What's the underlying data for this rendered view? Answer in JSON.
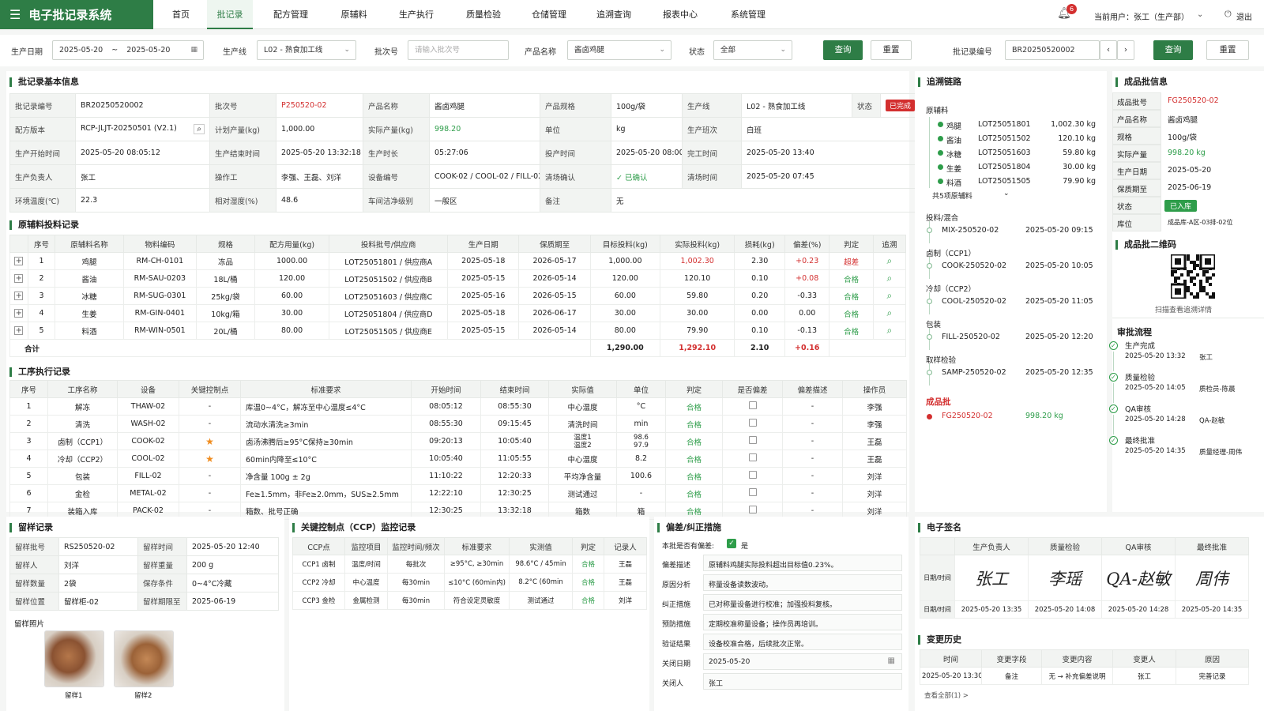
{
  "app": {
    "title": "电子批记录系统",
    "menu_icon": "menu-icon"
  },
  "nav": [
    "首页",
    "批记录",
    "配方管理",
    "原辅料",
    "生产执行",
    "质量检验",
    "仓储管理",
    "追溯查询",
    "报表中心",
    "系统管理"
  ],
  "header": {
    "notif_count": "6",
    "user": "当前用户：张工（生产部）",
    "logout": "退出"
  },
  "filters": {
    "date_label": "生产日期",
    "date_from": "2025-05-20",
    "date_sep": "~",
    "date_to": "2025-05-20",
    "line_label": "生产线",
    "line_value": "L02 - 熟食加工线",
    "batch_label": "批次号",
    "batch_placeholder": "请输入批次号",
    "product_label": "产品名称",
    "product_value": "酱卤鸡腿",
    "status_label": "状态",
    "status_value": "全部",
    "query": "查询",
    "reset": "重置",
    "record_label": "批记录编号",
    "record_value": "BR20250520002",
    "query2": "查询",
    "reset2": "重置"
  },
  "basic": {
    "title": "批记录基本信息",
    "rows": [
      [
        [
          "批记录编号",
          "BR20250520002"
        ],
        [
          "批次号",
          "P250520-02"
        ],
        [
          "产品名称",
          "酱卤鸡腿"
        ],
        [
          "产品规格",
          "100g/袋"
        ],
        [
          "生产线",
          "L02 - 熟食加工线"
        ],
        [
          "状态",
          "已完成"
        ]
      ],
      [
        [
          "配方版本",
          "RCP-JLJT-20250501 (V2.1)"
        ],
        [
          "计划产量(kg)",
          "1,000.00"
        ],
        [
          "实际产量(kg)",
          "998.20"
        ],
        [
          "单位",
          "kg"
        ],
        [
          "生产班次",
          "白班"
        ]
      ],
      [
        [
          "生产开始时间",
          "2025-05-20 08:05:12"
        ],
        [
          "生产结束时间",
          "2025-05-20 13:32:18"
        ],
        [
          "生产时长",
          "05:27:06"
        ],
        [
          "投产时间",
          "2025-05-20 08:00"
        ],
        [
          "完工时间",
          "2025-05-20 13:40"
        ]
      ],
      [
        [
          "生产负责人",
          "张工"
        ],
        [
          "操作工",
          "李强、王磊、刘洋"
        ],
        [
          "设备编号",
          "COOK-02 / COOL-02 / FILL-02"
        ],
        [
          "清场确认",
          "✓ 已确认"
        ],
        [
          "清场时间",
          "2025-05-20 07:45"
        ]
      ],
      [
        [
          "环境温度(℃)",
          "22.3"
        ],
        [
          "相对湿度(%)",
          "48.6"
        ],
        [
          "车间洁净级别",
          "一般区"
        ],
        [
          "备注",
          "无"
        ]
      ]
    ]
  },
  "materials": {
    "title": "原辅料投料记录",
    "headers": [
      "",
      "序号",
      "原辅料名称",
      "物料编码",
      "规格",
      "配方用量(kg)",
      "投料批号/供应商",
      "生产日期",
      "保质期至",
      "目标投料(kg)",
      "实际投料(kg)",
      "损耗(kg)",
      "偏差(%)",
      "判定",
      "追溯"
    ],
    "rows": [
      [
        "1",
        "鸡腿",
        "RM-CH-0101",
        "冻品",
        "1000.00",
        "LOT25051801 / 供应商A",
        "2025-05-18",
        "2026-05-17",
        "1,000.00",
        "1,002.30",
        "2.30",
        "+0.23",
        "超差"
      ],
      [
        "2",
        "酱油",
        "RM-SAU-0203",
        "18L/桶",
        "120.00",
        "LOT25051502 / 供应商B",
        "2025-05-15",
        "2026-05-14",
        "120.00",
        "120.10",
        "0.10",
        "+0.08",
        "合格"
      ],
      [
        "3",
        "冰糖",
        "RM-SUG-0301",
        "25kg/袋",
        "60.00",
        "LOT25051603 / 供应商C",
        "2025-05-16",
        "2026-05-15",
        "60.00",
        "59.80",
        "0.20",
        "-0.33",
        "合格"
      ],
      [
        "4",
        "生姜",
        "RM-GIN-0401",
        "10kg/箱",
        "30.00",
        "LOT25051804 / 供应商D",
        "2025-05-18",
        "2026-06-17",
        "30.00",
        "30.00",
        "0.00",
        "0.00",
        "合格"
      ],
      [
        "5",
        "料酒",
        "RM-WIN-0501",
        "20L/桶",
        "80.00",
        "LOT25051505 / 供应商E",
        "2025-05-15",
        "2026-05-14",
        "80.00",
        "79.90",
        "0.10",
        "-0.13",
        "合格"
      ]
    ],
    "total": [
      "合计",
      "1,290.00",
      "1,292.10",
      "2.10",
      "+0.16"
    ]
  },
  "process": {
    "title": "工序执行记录",
    "headers": [
      "序号",
      "工序名称",
      "设备",
      "关键控制点",
      "标准要求",
      "开始时间",
      "结束时间",
      "实际值",
      "单位",
      "判定",
      "是否偏差",
      "偏差描述",
      "操作员"
    ],
    "rows": [
      [
        "1",
        "解冻",
        "THAW-02",
        "-",
        "库温0~4°C，解冻至中心温度≤4°C",
        "08:05:12",
        "08:55:30",
        "中心温度",
        "°C",
        "合格",
        "-",
        "李强"
      ],
      [
        "2",
        "清洗",
        "WASH-02",
        "-",
        "流动水清洗≥3min",
        "08:55:30",
        "09:15:45",
        "清洗时间",
        "min",
        "合格",
        "-",
        "李强"
      ],
      [
        "3",
        "卤制（CCP1）",
        "COOK-02",
        "★",
        "卤汤沸腾后≥95°C保持≥30min",
        "09:20:13",
        "10:05:40",
        "温度1\n温度2",
        "98.6\n97.9",
        "合格",
        "-",
        "王磊"
      ],
      [
        "4",
        "冷却（CCP2）",
        "COOL-02",
        "★",
        "60min内降至≤10°C",
        "10:05:40",
        "11:05:55",
        "中心温度",
        "8.2",
        "合格",
        "-",
        "王磊"
      ],
      [
        "5",
        "包装",
        "FILL-02",
        "-",
        "净含量 100g ± 2g",
        "11:10:22",
        "12:20:33",
        "平均净含量",
        "100.6",
        "合格",
        "-",
        "刘洋"
      ],
      [
        "6",
        "金检",
        "METAL-02",
        "-",
        "Fe≥1.5mm，非Fe≥2.0mm，SUS≥2.5mm",
        "12:22:10",
        "12:30:25",
        "测试通过",
        "-",
        "合格",
        "-",
        "刘洋"
      ],
      [
        "7",
        "装箱入库",
        "PACK-02",
        "-",
        "箱数、批号正确",
        "12:30:25",
        "13:32:18",
        "箱数",
        "箱",
        "合格",
        "-",
        "刘洋"
      ]
    ]
  },
  "trace": {
    "title": "追溯链路",
    "raw_label": "原辅料",
    "raws": [
      [
        "鸡腿",
        "LOT25051801",
        "1,002.30 kg"
      ],
      [
        "酱油",
        "LOT25051502",
        "120.10 kg"
      ],
      [
        "冰糖",
        "LOT25051603",
        "59.80 kg"
      ],
      [
        "生姜",
        "LOT25051804",
        "30.00 kg"
      ],
      [
        "料酒",
        "LOT25051505",
        "79.90 kg"
      ]
    ],
    "raw_more": "共5项原辅料",
    "stages": [
      [
        "投料/混合",
        "MIX-250520-02",
        "2025-05-20 09:15"
      ],
      [
        "卤制（CCP1）",
        "COOK-250520-02",
        "2025-05-20 10:05"
      ],
      [
        "冷却（CCP2）",
        "COOL-250520-02",
        "2025-05-20 11:05"
      ],
      [
        "包装",
        "FILL-250520-02",
        "2025-05-20 12:20"
      ],
      [
        "取样检验",
        "SAMP-250520-02",
        "2025-05-20 12:35"
      ]
    ],
    "final_label": "成品批",
    "final_lot": "FG250520-02",
    "final_qty": "998.20 kg"
  },
  "fg": {
    "title": "成品批信息",
    "rows": [
      [
        "成品批号",
        "FG250520-02"
      ],
      [
        "产品名称",
        "酱卤鸡腿"
      ],
      [
        "规格",
        "100g/袋"
      ],
      [
        "实际产量",
        "998.20 kg"
      ],
      [
        "生产日期",
        "2025-05-20"
      ],
      [
        "保质期至",
        "2025-06-19"
      ],
      [
        "状态",
        "已入库"
      ],
      [
        "库位",
        "成品库-A区-03排-02位"
      ]
    ]
  },
  "qr": {
    "title": "成品批二维码",
    "caption": "扫描查看追溯详情"
  },
  "approval": {
    "title": "审批流程",
    "steps": [
      [
        "生产完成",
        "2025-05-20 13:32",
        "张工"
      ],
      [
        "质量检验",
        "2025-05-20 14:05",
        "质检员-陈晨"
      ],
      [
        "QA审核",
        "2025-05-20 14:28",
        "QA-赵敏"
      ],
      [
        "最终批准",
        "2025-05-20 14:35",
        "质量经理-周伟"
      ]
    ]
  },
  "retain": {
    "title": "留样记录",
    "rows": [
      [
        "留样批号",
        "RS250520-02",
        "留样时间",
        "2025-05-20 12:40"
      ],
      [
        "留样人",
        "刘洋",
        "留样重量",
        "200 g"
      ],
      [
        "留样数量",
        "2袋",
        "保存条件",
        "0~4°C冷藏"
      ],
      [
        "留样位置",
        "留样柜-02",
        "留样期限至",
        "2025-06-19"
      ]
    ],
    "photo_label": "留样照片",
    "photos": [
      "留样1",
      "留样2"
    ]
  },
  "ccp": {
    "title": "关键控制点（CCP）监控记录",
    "headers": [
      "CCP点",
      "监控项目",
      "监控时间/频次",
      "标准要求",
      "实测值",
      "判定",
      "记录人"
    ],
    "rows": [
      [
        "CCP1 卤制",
        "温度/时间",
        "每批次",
        "≥95°C, ≥30min",
        "98.6°C / 45min",
        "合格",
        "王磊"
      ],
      [
        "CCP2 冷却",
        "中心温度",
        "每30min",
        "≤10°C (60min内)",
        "8.2°C (60min",
        "合格",
        "王磊"
      ],
      [
        "CCP3 金检",
        "金属检测",
        "每30min",
        "符合设定灵敏度",
        "测试通过",
        "合格",
        "刘洋"
      ]
    ]
  },
  "deviation": {
    "title": "偏差/纠正措施",
    "has_label": "本批是否有偏差:",
    "has_value": "是",
    "rows": [
      [
        "偏差描述",
        "原辅料鸡腿实际投料超出目标值0.23%。"
      ],
      [
        "原因分析",
        "称量设备读数波动。"
      ],
      [
        "纠正措施",
        "已对称量设备进行校准；加强投料复核。"
      ],
      [
        "预防措施",
        "定期校准称量设备；操作员再培训。"
      ],
      [
        "验证结果",
        "设备校准合格，后续批次正常。"
      ],
      [
        "关闭日期",
        "2025-05-20"
      ],
      [
        "关闭人",
        "张工"
      ]
    ]
  },
  "esign": {
    "title": "电子签名",
    "roles": [
      "生产负责人",
      "质量检验",
      "QA审核",
      "最终批准"
    ],
    "row1_label": "日期/时间",
    "row2_label": "日期/时间",
    "signs": [
      "张工",
      "李瑶",
      "QA-赵敏",
      "周伟"
    ],
    "times": [
      "2025-05-20 13:35",
      "2025-05-20 14:08",
      "2025-05-20 14:28",
      "2025-05-20 14:35"
    ]
  },
  "history": {
    "title": "变更历史",
    "headers": [
      "时间",
      "变更字段",
      "变更内容",
      "变更人",
      "原因"
    ],
    "rows": [
      [
        "2025-05-20 13:30",
        "备注",
        "无 → 补充偏差说明",
        "张工",
        "完善记录"
      ]
    ],
    "more": "查看全部(1) >"
  },
  "colors": {
    "brand": "#2e7d46",
    "danger": "#d32f2f",
    "ok": "#2e9d4a"
  }
}
